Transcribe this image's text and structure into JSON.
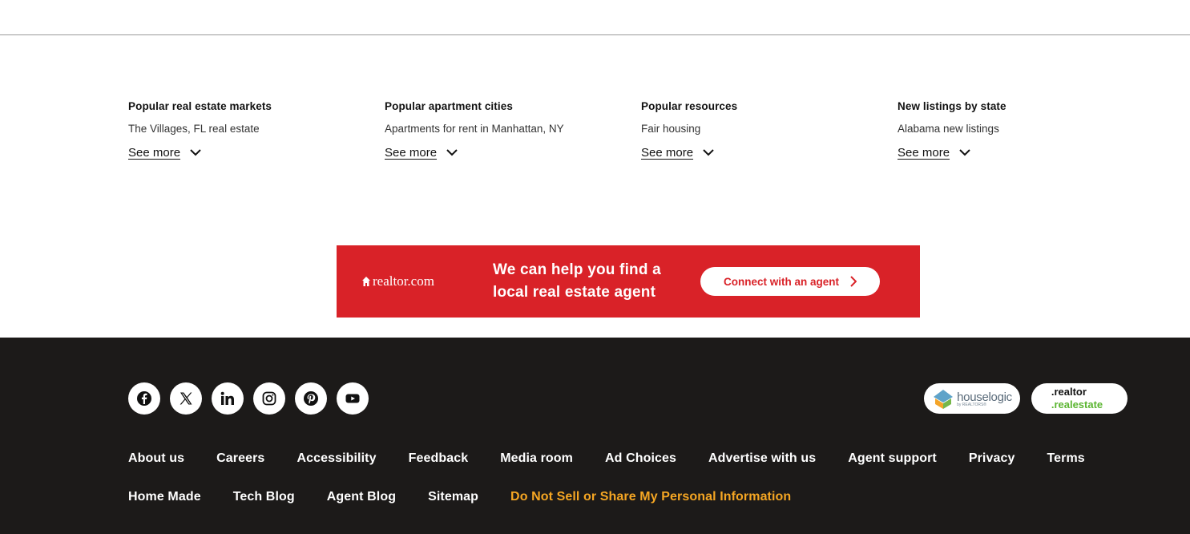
{
  "columns": [
    {
      "title": "Popular real estate markets",
      "item": "The Villages, FL real estate",
      "see_more": "See more"
    },
    {
      "title": "Popular apartment cities",
      "item": "Apartments for rent in Manhattan, NY",
      "see_more": "See more"
    },
    {
      "title": "Popular resources",
      "item": "Fair housing",
      "see_more": "See more"
    },
    {
      "title": "New listings by state",
      "item": "Alabama new listings",
      "see_more": "See more"
    }
  ],
  "banner": {
    "brand": "realtor.com",
    "message_line1": "We can help you find a",
    "message_line2": "local real estate agent",
    "cta_label": "Connect with an agent",
    "background": "#d92228"
  },
  "social_icons": [
    "facebook-icon",
    "x-icon",
    "linkedin-icon",
    "instagram-icon",
    "pinterest-icon",
    "youtube-icon"
  ],
  "partners": {
    "houselogic": {
      "name": "houselogic",
      "sub": "by REALTORS®"
    },
    "realtor_realestate": {
      "top": ".realtor",
      "bottom": ".realestate"
    }
  },
  "footer_links_row1": [
    "About us",
    "Careers",
    "Accessibility",
    "Feedback",
    "Media room",
    "Ad Choices",
    "Advertise with us",
    "Agent support",
    "Privacy",
    "Terms"
  ],
  "footer_links_row2": [
    "Home Made",
    "Tech Blog",
    "Agent Blog",
    "Sitemap",
    "Do Not Sell or Share My Personal Information"
  ],
  "colors": {
    "footer_bg": "#1c1a19",
    "highlight_link": "#f5a623",
    "accent_green": "#5bb531"
  }
}
